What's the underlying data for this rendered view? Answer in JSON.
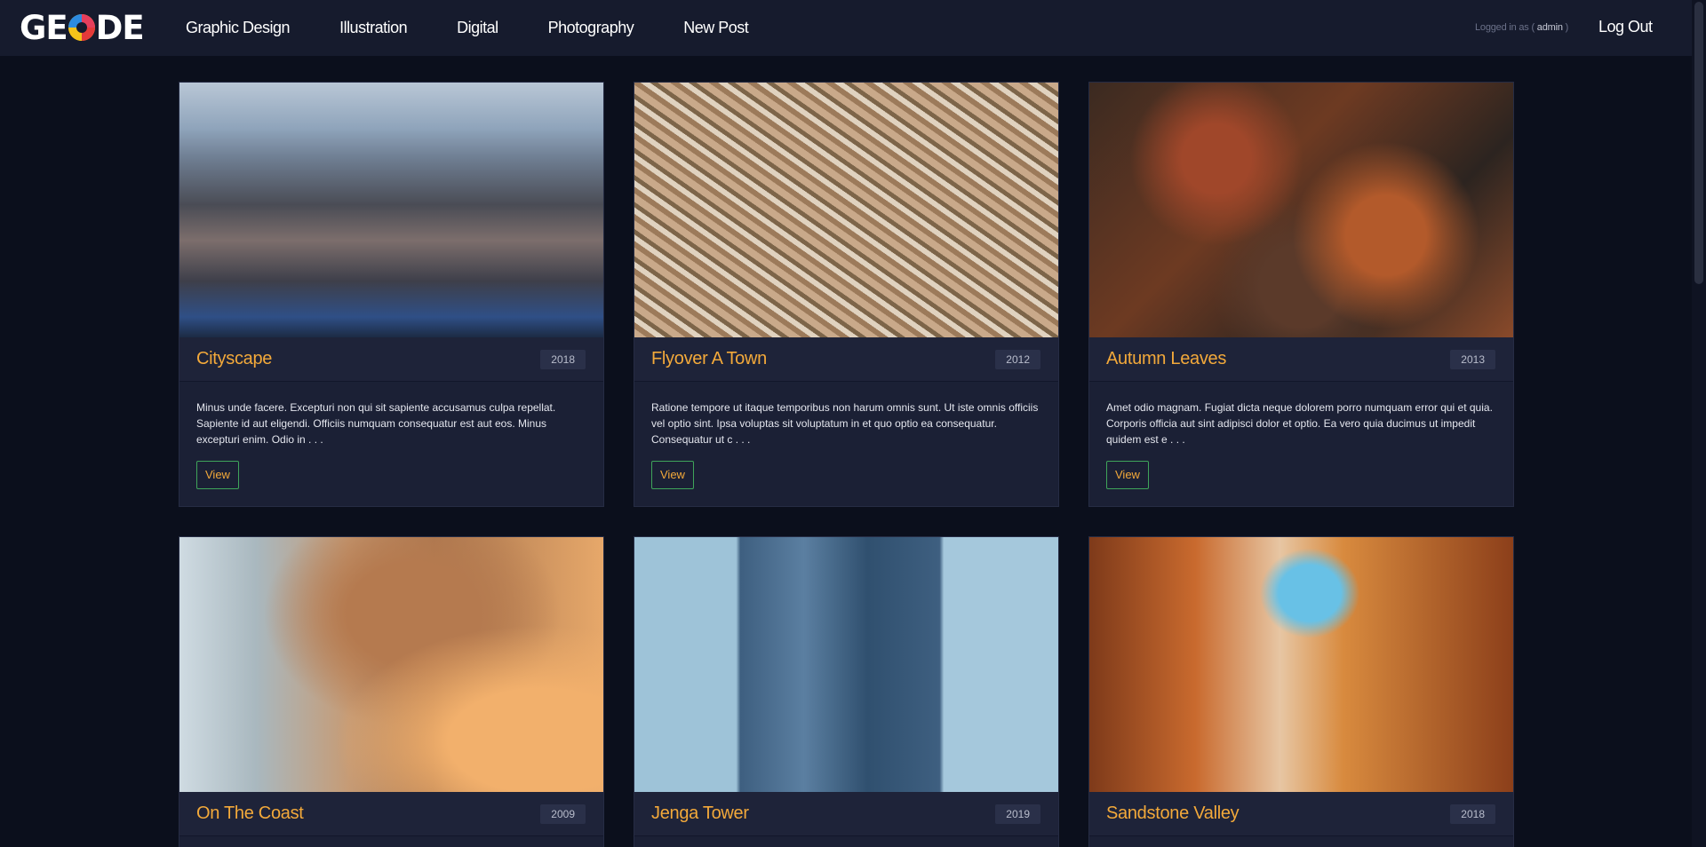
{
  "header": {
    "logo_text_left": "GE",
    "logo_text_right": "DE",
    "nav": [
      "Graphic Design",
      "Illustration",
      "Digital",
      "Photography",
      "New Post"
    ],
    "logged_in_prefix": "Logged in as (",
    "logged_in_user": "admin",
    "logged_in_suffix": ")",
    "logout_label": "Log Out"
  },
  "cards": [
    {
      "title": "Cityscape",
      "year": "2018",
      "excerpt": "Minus unde facere. Excepturi non qui sit sapiente accusamus culpa repellat. Sapiente id aut eligendi. Officiis numquam consequatur est aut eos. Minus excepturi enim. Odio in . . .",
      "button": "View"
    },
    {
      "title": "Flyover A Town",
      "year": "2012",
      "excerpt": "Ratione tempore ut itaque temporibus non harum omnis sunt. Ut iste omnis officiis vel optio sint. Ipsa voluptas sit voluptatum in et quo optio ea consequatur. Consequatur ut c . . .",
      "button": "View"
    },
    {
      "title": "Autumn Leaves",
      "year": "2013",
      "excerpt": "Amet odio magnam. Fugiat dicta neque dolorem porro numquam error qui et quia. Corporis officia aut sint adipisci dolor et optio. Ea vero quia ducimus ut impedit quidem est e . . .",
      "button": "View"
    },
    {
      "title": "On The Coast",
      "year": "2009"
    },
    {
      "title": "Jenga Tower",
      "year": "2019"
    },
    {
      "title": "Sandstone Valley",
      "year": "2018"
    }
  ]
}
